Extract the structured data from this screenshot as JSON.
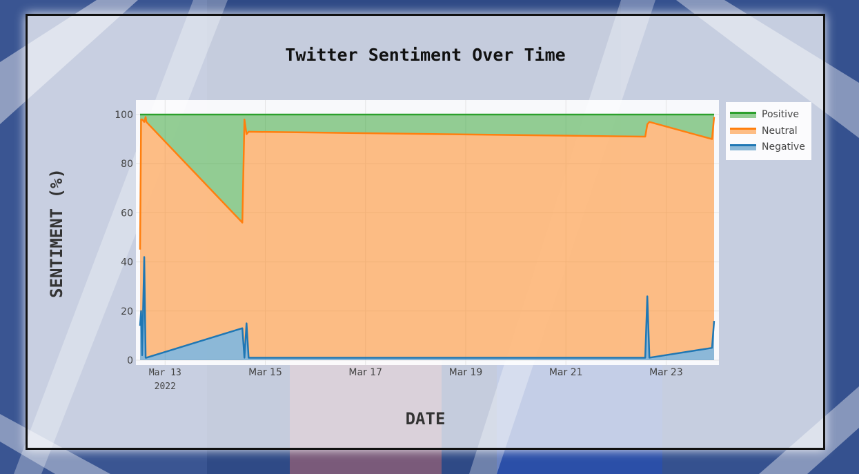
{
  "chart_data": {
    "type": "area",
    "title": "Twitter Sentiment Over Time",
    "xlabel": "DATE",
    "ylabel": "SENTIMENT (%)",
    "x_tick_labels": [
      "Mar 13",
      "Mar 15",
      "Mar 17",
      "Mar 19",
      "Mar 21",
      "Mar 23"
    ],
    "x_year_label": "2022",
    "y_tick_labels": [
      "0",
      "20",
      "40",
      "60",
      "80",
      "100"
    ],
    "ylim": [
      0,
      100
    ],
    "xlim": [
      "2022-03-12 12:00",
      "2022-03-23 23:00"
    ],
    "stacked": true,
    "legend_position": "top-right",
    "grid": true,
    "x": [
      "2022-03-12 12:00",
      "2022-03-12 12:30",
      "2022-03-12 13:00",
      "2022-03-12 14:00",
      "2022-03-12 14:40",
      "2022-03-12 15:00",
      "2022-03-14 13:00",
      "2022-03-14 14:00",
      "2022-03-14 15:00",
      "2022-03-14 16:00",
      "2022-03-22 14:00",
      "2022-03-22 15:00",
      "2022-03-22 16:00",
      "2022-03-23 22:00",
      "2022-03-23 23:00"
    ],
    "series": [
      {
        "name": "Negative",
        "color": "#1f77b4",
        "values": [
          14,
          20,
          2,
          42,
          1,
          1,
          13,
          1,
          15,
          1,
          1,
          26,
          1,
          5,
          16
        ]
      },
      {
        "name": "Neutral",
        "color": "#ff7f0e",
        "values": [
          31,
          78,
          96,
          55,
          98,
          96,
          43,
          97,
          77,
          92,
          90,
          70,
          96,
          85,
          83
        ]
      },
      {
        "name": "Positive",
        "color": "#2ca02c",
        "values": [
          55,
          2,
          2,
          3,
          1,
          3,
          44,
          2,
          8,
          7,
          9,
          4,
          3,
          10,
          1
        ]
      }
    ]
  }
}
